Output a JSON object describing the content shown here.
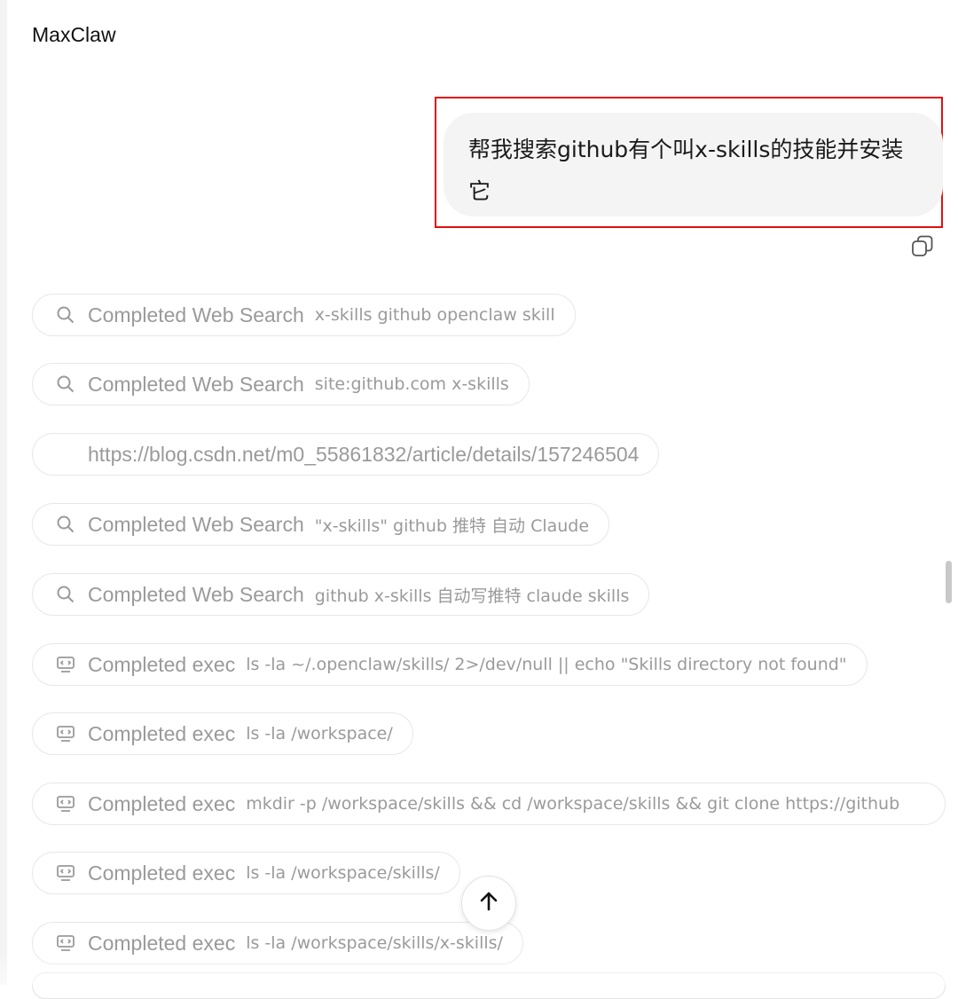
{
  "app": {
    "title": "MaxClaw"
  },
  "user_message": {
    "text": "帮我搜索github有个叫x-skills的技能并安装它"
  },
  "steps": [
    {
      "icon": "search-icon",
      "status": "Completed Web Search",
      "detail": "x-skills github openclaw skill"
    },
    {
      "icon": "search-icon",
      "status": "Completed Web Search",
      "detail": "site:github.com x-skills"
    },
    {
      "icon": "",
      "status": "",
      "detail": "https://blog.csdn.net/m0_55861832/article/details/157246504"
    },
    {
      "icon": "search-icon",
      "status": "Completed Web Search",
      "detail": "\"x-skills\" github 推特 自动 Claude"
    },
    {
      "icon": "search-icon",
      "status": "Completed Web Search",
      "detail": "github x-skills 自动写推特 claude skills"
    },
    {
      "icon": "terminal-icon",
      "status": "Completed exec",
      "detail": "ls -la ~/.openclaw/skills/ 2>/dev/null || echo \"Skills directory not found\""
    },
    {
      "icon": "terminal-icon",
      "status": "Completed exec",
      "detail": "ls -la /workspace/"
    },
    {
      "icon": "terminal-icon",
      "status": "Completed exec",
      "detail": "mkdir -p /workspace/skills && cd /workspace/skills && git clone https://github"
    },
    {
      "icon": "terminal-icon",
      "status": "Completed exec",
      "detail": "ls -la /workspace/skills/"
    },
    {
      "icon": "terminal-icon",
      "status": "Completed exec",
      "detail": "ls -la /workspace/skills/x-skills/"
    }
  ],
  "colors": {
    "highlight_border": "#e01010",
    "bubble_bg": "#f4f4f4",
    "muted_text": "#9a9a9a"
  }
}
